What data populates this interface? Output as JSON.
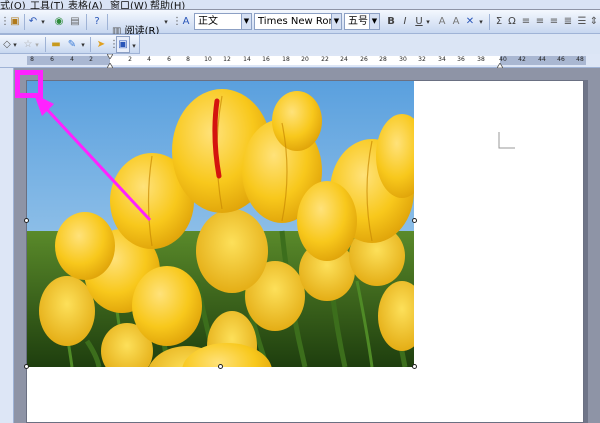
{
  "menu": {
    "items": [
      "式(O)",
      "工具(T)",
      "表格(A)",
      "窗口(W)",
      "帮助(H)"
    ]
  },
  "toolbar": {
    "review_label": "阅读(R)",
    "style_value": "正文",
    "font_value": "Times New Roman",
    "size_value": "五号",
    "bold": "B",
    "italic": "I",
    "underline": "U",
    "sigma": "Σ",
    "omega": "Ω"
  },
  "ruler": {
    "ticks": [
      "8",
      "6",
      "4",
      "2",
      "2",
      "4",
      "6",
      "8",
      "10",
      "12",
      "14",
      "16",
      "18",
      "20",
      "22",
      "24",
      "26",
      "28",
      "30",
      "32",
      "34",
      "36",
      "38",
      "40",
      "42",
      "44",
      "46",
      "48"
    ]
  },
  "colors": {
    "highlight": "#ff22ff",
    "toolbar_bg": "#d9e3f5",
    "workspace": "#8e94a6"
  }
}
